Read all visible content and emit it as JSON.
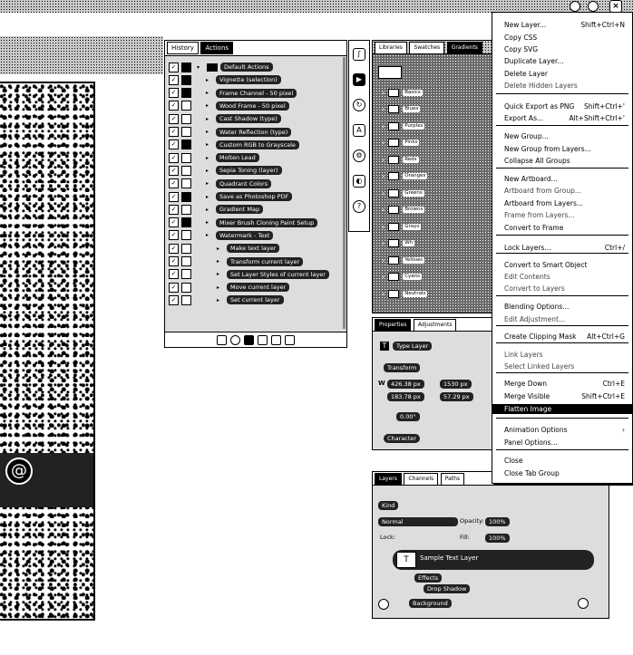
{
  "menu": {
    "items": [
      {
        "label": "New Layer...",
        "shortcut": "Shift+Ctrl+N",
        "enabled": true
      },
      {
        "label": "Copy CSS",
        "shortcut": "",
        "enabled": true
      },
      {
        "label": "Copy SVG",
        "shortcut": "",
        "enabled": true
      },
      {
        "label": "Duplicate Layer...",
        "shortcut": "",
        "enabled": true
      },
      {
        "label": "Delete Layer",
        "shortcut": "",
        "enabled": true
      },
      {
        "label": "Delete Hidden Layers",
        "shortcut": "",
        "enabled": false
      },
      {
        "label": "Quick Export as PNG",
        "shortcut": "Shift+Ctrl+'",
        "enabled": true
      },
      {
        "label": "Export As...",
        "shortcut": "Alt+Shift+Ctrl+'",
        "enabled": true
      },
      {
        "label": "New Group...",
        "shortcut": "",
        "enabled": true
      },
      {
        "label": "New Group from Layers...",
        "shortcut": "",
        "enabled": true
      },
      {
        "label": "Collapse All Groups",
        "shortcut": "",
        "enabled": true
      },
      {
        "label": "New Artboard...",
        "shortcut": "",
        "enabled": true
      },
      {
        "label": "Artboard from Group...",
        "shortcut": "",
        "enabled": false
      },
      {
        "label": "Artboard from Layers...",
        "shortcut": "",
        "enabled": true
      },
      {
        "label": "Frame from Layers...",
        "shortcut": "",
        "enabled": false
      },
      {
        "label": "Convert to Frame",
        "shortcut": "",
        "enabled": true
      },
      {
        "label": "Lock Layers...",
        "shortcut": "Ctrl+/",
        "enabled": true
      },
      {
        "label": "Convert to Smart Object",
        "shortcut": "",
        "enabled": true
      },
      {
        "label": "Edit Contents",
        "shortcut": "",
        "enabled": false
      },
      {
        "label": "Convert to Layers",
        "shortcut": "",
        "enabled": false
      },
      {
        "label": "Blending Options...",
        "shortcut": "",
        "enabled": true
      },
      {
        "label": "Edit Adjustment...",
        "shortcut": "",
        "enabled": false
      },
      {
        "label": "Create Clipping Mask",
        "shortcut": "Alt+Ctrl+G",
        "enabled": true
      },
      {
        "label": "Link Layers",
        "shortcut": "",
        "enabled": false
      },
      {
        "label": "Select Linked Layers",
        "shortcut": "",
        "enabled": false
      },
      {
        "label": "Merge Down",
        "shortcut": "Ctrl+E",
        "enabled": true
      },
      {
        "label": "Merge Visible",
        "shortcut": "Shift+Ctrl+E",
        "enabled": true
      },
      {
        "label": "Flatten Image",
        "shortcut": "",
        "enabled": true,
        "highlighted": true
      },
      {
        "label": "Animation Options",
        "shortcut": "›",
        "enabled": true
      },
      {
        "label": "Panel Options...",
        "shortcut": "",
        "enabled": true
      },
      {
        "label": "Close",
        "shortcut": "",
        "enabled": true
      },
      {
        "label": "Close Tab Group",
        "shortcut": "",
        "enabled": true
      }
    ]
  },
  "actions_panel": {
    "tabs": [
      "History",
      "Actions"
    ],
    "items": [
      {
        "label": "Default Actions",
        "type": "folder"
      },
      {
        "label": "Vignette (selection)"
      },
      {
        "label": "Frame Channel - 50 pixel"
      },
      {
        "label": "Wood Frame - 50 pixel"
      },
      {
        "label": "Cast Shadow (type)"
      },
      {
        "label": "Water Reflection (type)"
      },
      {
        "label": "Custom RGB to Grayscale"
      },
      {
        "label": "Molten Lead"
      },
      {
        "label": "Sepia Toning (layer)"
      },
      {
        "label": "Quadrant Colors"
      },
      {
        "label": "Save as Photoshop PDF"
      },
      {
        "label": "Gradient Map"
      },
      {
        "label": "Mixer Brush Cloning Paint Setup"
      },
      {
        "label": "Watermark - Text"
      },
      {
        "label": "Make text layer"
      },
      {
        "label": "Transform current layer"
      },
      {
        "label": "Set Layer Styles of current layer"
      },
      {
        "label": "Move current layer"
      },
      {
        "label": "Set current layer"
      }
    ]
  },
  "library_panel": {
    "tabs": [
      "Libraries",
      "Swatches",
      "Gradients"
    ],
    "folders": [
      "Basics",
      "Blues",
      "Purples",
      "Pinks",
      "Reds",
      "Oranges",
      "Greens",
      "Browns",
      "Grays",
      "Wh",
      "Yellows",
      "Cyans",
      "Neutrals"
    ]
  },
  "properties_panel": {
    "tabs": [
      "Properties",
      "Adjustments"
    ],
    "layer_type": "Type Layer",
    "section": "Transform",
    "w": "426.38 px",
    "h": "183.78 px",
    "x": "1530 px",
    "y": "57.29 px",
    "angle": "0.00°",
    "button": "Character"
  },
  "layers_panel": {
    "tabs": [
      "Layers",
      "Channels",
      "Paths"
    ],
    "filter": "Kind",
    "blend_mode": "Normal",
    "opacity_label": "Opacity:",
    "opacity": "100%",
    "lock_label": "Lock:",
    "fill_label": "Fill:",
    "fill": "100%",
    "layers": [
      {
        "name": "Sample Text Layer",
        "selected": true
      },
      {
        "name": "Effects"
      },
      {
        "name": "Drop Shadow"
      },
      {
        "name": "Background"
      }
    ]
  },
  "tools": [
    "brush-icon",
    "play-icon",
    "rotate-icon",
    "type-icon",
    "gear-icon",
    "adjust-icon",
    "help-icon"
  ]
}
